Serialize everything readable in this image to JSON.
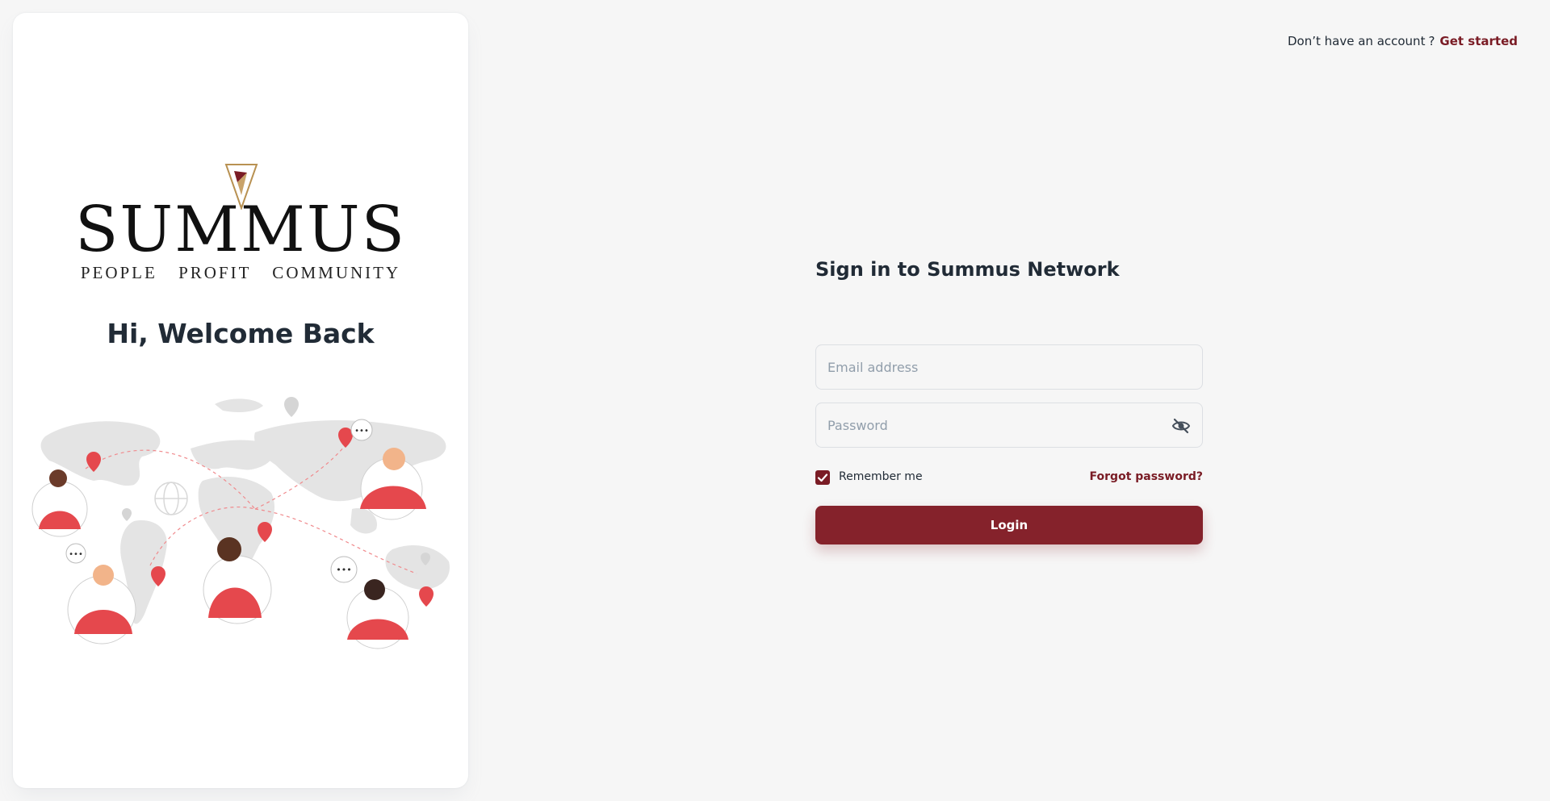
{
  "brand": {
    "wordmark": "SUMMUS",
    "tagline": "PEOPLE PROFIT COMMUNITY"
  },
  "left_panel": {
    "heading": "Hi, Welcome Back"
  },
  "header": {
    "prompt": "Don’t have an account",
    "question_mark": "?",
    "get_started": "Get started"
  },
  "form": {
    "title": "Sign in to Summus Network",
    "email_placeholder": "Email address",
    "password_placeholder": "Password",
    "remember_label": "Remember me",
    "remember_checked": true,
    "forgot_label": "Forgot password?",
    "login_label": "Login"
  },
  "icons": {
    "password_toggle": "eye-off-icon",
    "checkbox": "check-icon"
  },
  "colors": {
    "accent": "#7a1c25",
    "button": "#85222b",
    "illustration_red": "#e5484d",
    "map_gray": "#e3e3e3",
    "background": "#f6f6f6"
  }
}
